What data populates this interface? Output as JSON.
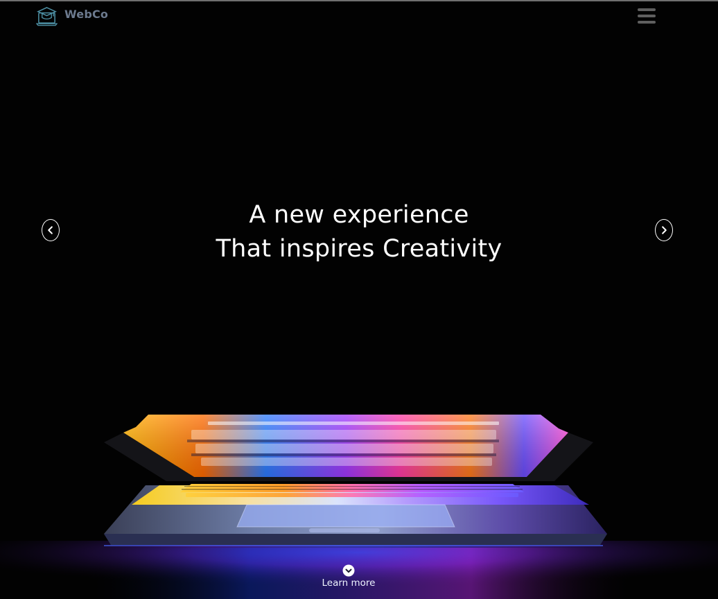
{
  "brand": {
    "name": "WebCo",
    "logo_icon": "laptop-graduation-cap-icon",
    "color": "#6c7a8e"
  },
  "header": {
    "menu_icon": "hamburger-menu-icon"
  },
  "hero": {
    "headline_line1": "A new experience",
    "headline_line2": "That inspires Creativity",
    "prev_icon": "chevron-left-icon",
    "next_icon": "chevron-right-icon",
    "image_subject": "laptop-with-colorful-glowing-screen"
  },
  "learn_more": {
    "label": "Learn more",
    "icon": "chevron-down-circle-icon"
  },
  "colors": {
    "background": "#020202",
    "text": "#ffffff",
    "accent_blue": "#1e6cff",
    "accent_magenta": "#c02cff",
    "accent_yellow": "#ffd21a"
  }
}
